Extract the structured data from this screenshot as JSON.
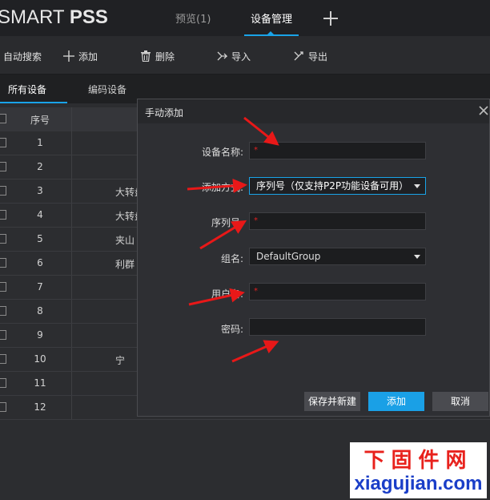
{
  "app": {
    "brand_light": "SMART ",
    "brand_bold": "PSS"
  },
  "top_tabs": [
    {
      "label": "预览(1)"
    },
    {
      "label": "设备管理"
    }
  ],
  "toolbar": {
    "auto_search": "自动搜索",
    "add": "添加",
    "delete": "删除",
    "import": "导入",
    "export": "导出"
  },
  "sub_tabs": [
    {
      "label": "所有设备"
    },
    {
      "label": "编码设备"
    }
  ],
  "table": {
    "col_no": "序号",
    "rows": [
      {
        "no": "1",
        "name": ""
      },
      {
        "no": "2",
        "name": ""
      },
      {
        "no": "3",
        "name": "大转盘"
      },
      {
        "no": "4",
        "name": "大转盘"
      },
      {
        "no": "5",
        "name": "夹山"
      },
      {
        "no": "6",
        "name": "利群"
      },
      {
        "no": "7",
        "name": ""
      },
      {
        "no": "8",
        "name": ""
      },
      {
        "no": "9",
        "name": ""
      },
      {
        "no": "10",
        "name": "宁"
      },
      {
        "no": "11",
        "name": ""
      },
      {
        "no": "12",
        "name": ""
      }
    ]
  },
  "dialog": {
    "title": "手动添加",
    "device_name_label": "设备名称:",
    "device_name_value": "",
    "add_method_label": "添加方式:",
    "add_method_value": "序列号（仅支持P2P功能设备可用）",
    "serial_label": "序列号:",
    "serial_value": "",
    "group_label": "组名:",
    "group_value": "DefaultGroup",
    "username_label": "用户名:",
    "username_value": "",
    "password_label": "密码:",
    "password_value": "",
    "required_mark": "*",
    "save_new_label": "保存并新建",
    "add_label": "添加",
    "cancel_label": "取消"
  },
  "watermark": {
    "line1": "下固件网",
    "line2": "xiagujian.com"
  },
  "colors": {
    "accent": "#19a3e8",
    "annotation_arrow": "#e81818",
    "required": "#e02020"
  }
}
